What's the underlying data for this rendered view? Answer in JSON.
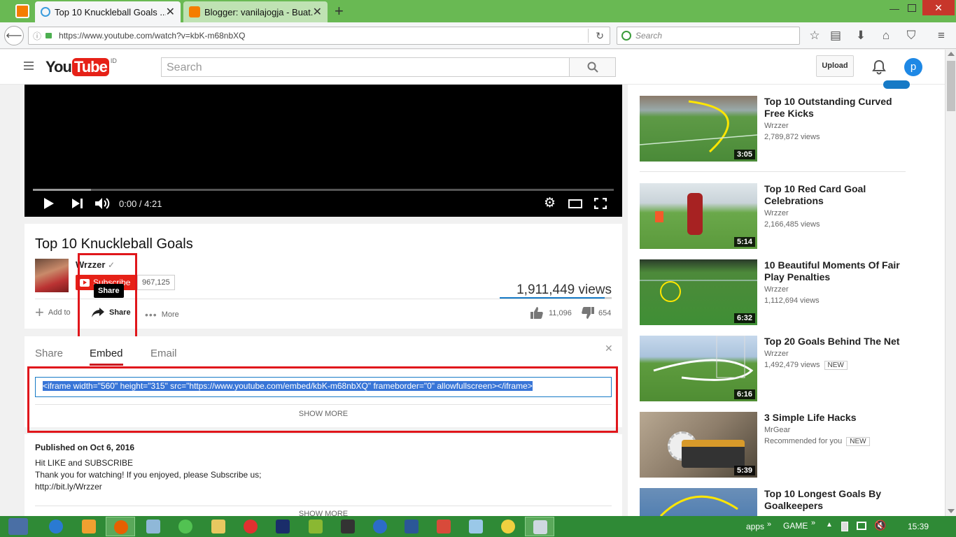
{
  "browser": {
    "tabs": [
      {
        "label": "Top 10 Knuckleball Goals ...",
        "active": true
      },
      {
        "label": "Blogger: vanilajogja - Buat...",
        "active": false
      }
    ],
    "new_tab": "+",
    "url": "https://www.youtube.com/watch?v=kbK-m68nbXQ",
    "search_placeholder": "Search"
  },
  "youtube": {
    "logo_you": "You",
    "logo_tube": "Tube",
    "logo_region": "ID",
    "search_placeholder": "Search",
    "upload_label": "Upload",
    "avatar_letter": "p"
  },
  "player": {
    "time": "0:00 / 4:21",
    "progress_fraction": 0.0
  },
  "video": {
    "title": "Top 10 Knuckleball Goals",
    "channel": "Wrzzer",
    "verified": "✓",
    "subscribe_label": "Subscribe",
    "subscriber_count": "967,125",
    "views": "1,911,449 views",
    "add_to_label": "Add to",
    "share_label": "Share",
    "share_tooltip": "Share",
    "more_label": "More",
    "likes": "11,096",
    "dislikes": "654"
  },
  "share_panel": {
    "tabs": [
      "Share",
      "Embed",
      "Email"
    ],
    "active_tab": "Embed",
    "embed_code": "<iframe width=\"560\" height=\"315\" src=\"https://www.youtube.com/embed/kbK-m68nbXQ\" frameborder=\"0\" allowfullscreen></iframe>",
    "show_more": "SHOW MORE"
  },
  "description": {
    "published": "Published on Oct 6, 2016",
    "lines": [
      "Hit LIKE and SUBSCRIBE",
      "Thank you for watching! If you enjoyed, please Subscribe us;",
      "http://bit.ly/Wrzzer"
    ],
    "show_more": "SHOW MORE"
  },
  "sidebar": [
    {
      "title": "Top 10 Outstanding Curved Free Kicks",
      "channel": "Wrzzer",
      "views": "2,789,872 views",
      "duration": "3:05",
      "badge": ""
    },
    {
      "title": "Top 10 Red Card Goal Celebrations",
      "channel": "Wrzzer",
      "views": "2,166,485 views",
      "duration": "5:14",
      "badge": ""
    },
    {
      "title": "10 Beautiful Moments Of Fair Play Penalties",
      "channel": "Wrzzer",
      "views": "1,112,694 views",
      "duration": "6:32",
      "badge": ""
    },
    {
      "title": "Top 20 Goals Behind The Net",
      "channel": "Wrzzer",
      "views": "1,492,479 views",
      "duration": "6:16",
      "badge": "NEW"
    },
    {
      "title": "3 Simple Life Hacks",
      "channel": "MrGear",
      "views": "Recommended for you",
      "duration": "5:39",
      "badge": "NEW"
    },
    {
      "title": "Top 10 Longest Goals By Goalkeepers",
      "channel": "",
      "views": "",
      "duration": "",
      "badge": ""
    }
  ],
  "taskbar": {
    "apps_label": "apps",
    "game_label": "GAME",
    "clock": "15:39"
  },
  "colors": {
    "browser_tabbar": "#69b953",
    "youtube_red": "#e62117",
    "highlight_red": "#e0161b",
    "selection_blue": "#3875d7",
    "taskbar": "#2f8a36",
    "avatar_blue": "#1e88e5"
  }
}
